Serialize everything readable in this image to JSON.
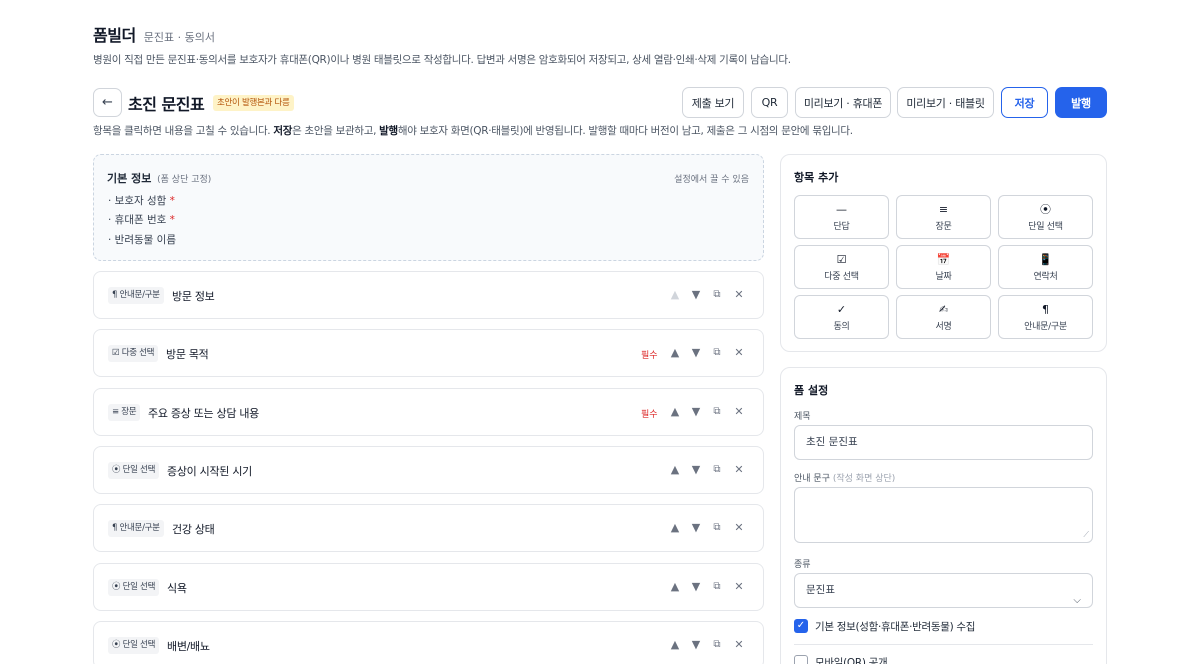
{
  "header": {
    "title": "폼빌더",
    "subtitle": "문진표 · 동의서",
    "description": "병원이 직접 만든 문진표·동의서를 보호자가 휴대폰(QR)이나 병원 태블릿으로 작성합니다. 답변과 서명은 암호화되어 저장되고, 상세 열람·인쇄·삭제 기록이 남습니다."
  },
  "toolbar": {
    "back_icon": "arrow-left-icon",
    "form_name": "초진 문진표",
    "draft_badge": "초안이 발행본과 다름",
    "buttons": {
      "submissions": "제출 보기",
      "qr": "QR",
      "preview_mobile": "미리보기 · 휴대폰",
      "preview_tablet": "미리보기 · 태블릿",
      "save": "저장",
      "publish": "발행"
    },
    "colors": {
      "primary": "#2563eb",
      "badge_bg": "#fef3c7",
      "badge_text": "#b45309"
    }
  },
  "hint": {
    "part1": "항목을 클릭하면 내용을 고칠 수 있습니다. ",
    "save_word": "저장",
    "part2": "은 초안을 보관하고, ",
    "publish_word": "발행",
    "part3": "해야 보호자 화면(QR·태블릿)에 반영됩니다. 발행할 때마다 버전이 남고, 제출은 그 시점의 문안에 묶입니다."
  },
  "basic_info": {
    "title": "기본 정보",
    "note": "(폼 상단 고정)",
    "settings_hint": "설정에서 끌 수 있음",
    "items": [
      {
        "label": "· 보호자 성함",
        "required": "*"
      },
      {
        "label": "· 휴대폰 번호",
        "required": "*"
      },
      {
        "label": "· 반려동물 이름",
        "required": ""
      }
    ]
  },
  "questions": [
    {
      "type_icon": "¶",
      "type": "안내문/구분",
      "label": "방문 정보",
      "required": ""
    },
    {
      "type_icon": "☑",
      "type": "다중 선택",
      "label": "방문 목적",
      "required": "필수"
    },
    {
      "type_icon": "≡",
      "type": "장문",
      "label": "주요 증상 또는 상담 내용",
      "required": "필수"
    },
    {
      "type_icon": "⦿",
      "type": "단일 선택",
      "label": "증상이 시작된 시기",
      "required": ""
    },
    {
      "type_icon": "¶",
      "type": "안내문/구분",
      "label": "건강 상태",
      "required": ""
    },
    {
      "type_icon": "⦿",
      "type": "단일 선택",
      "label": "식욕",
      "required": ""
    },
    {
      "type_icon": "⦿",
      "type": "단일 선택",
      "label": "배변/배뇨",
      "required": ""
    }
  ],
  "question_actions": {
    "up": "▲",
    "down": "▼",
    "copy": "⧉",
    "delete": "✕"
  },
  "add_panel": {
    "title": "항목 추가",
    "items": [
      {
        "icon": "—",
        "label": "단답"
      },
      {
        "icon": "≡",
        "label": "장문"
      },
      {
        "icon": "⦿",
        "label": "단일 선택"
      },
      {
        "icon": "☑",
        "label": "다중 선택"
      },
      {
        "icon": "📅",
        "label": "날짜"
      },
      {
        "icon": "📱",
        "label": "연락처"
      },
      {
        "icon": "✓",
        "label": "동의"
      },
      {
        "icon": "✍",
        "label": "서명"
      },
      {
        "icon": "¶",
        "label": "안내문/구분"
      }
    ]
  },
  "form_settings": {
    "title": "폼 설정",
    "title_label": "제목",
    "title_value": "초진 문진표",
    "intro_label": "안내 문구",
    "intro_note": "(작성 화면 상단)",
    "intro_value": "",
    "kind_label": "종류",
    "kind_value": "문진표",
    "collect_basic": {
      "label": "기본 정보(성함·휴대폰·반려동물) 수집",
      "checked": true
    },
    "mobile_public": {
      "label": "모바일(QR) 공개",
      "checked": false
    }
  }
}
